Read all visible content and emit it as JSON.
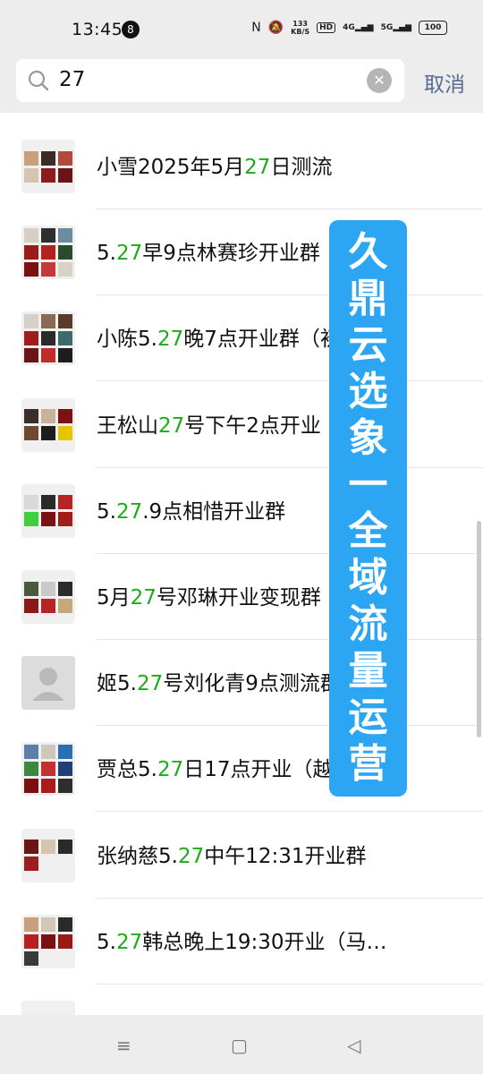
{
  "status_bar": {
    "time": "13:45",
    "badge": "8",
    "speed_top": "133",
    "speed_unit": "KB/S",
    "hd": "HD",
    "sig1": "4G",
    "sig2": "5G",
    "battery": "100"
  },
  "search": {
    "query": "27",
    "cancel_label": "取消"
  },
  "results": [
    {
      "pre": "小雪2025年5月",
      "hl": "27",
      "post": "日测流",
      "avatar": "grid",
      "colors": [
        "#c9a07a",
        "#3a2b26",
        "#b04a3c",
        "#d7c3b0",
        "#8b1c1c",
        "#6d1313"
      ]
    },
    {
      "pre": "5.",
      "hl": "27",
      "post": "早9点林赛珍开业群（新",
      "avatar": "grid",
      "colors": [
        "#d8cfc4",
        "#2f2f2f",
        "#6a8ba0",
        "#9b1a1a",
        "#b32222",
        "#2a4a2a",
        "#7b1111",
        "#c23a3a",
        "#d9d2c7"
      ]
    },
    {
      "pre": "小陈5.",
      "hl": "27",
      "post": "晚7点开业群（初选）",
      "avatar": "grid",
      "colors": [
        "#d6d0c8",
        "#8a6b52",
        "#5b3a2a",
        "#a11d1d",
        "#2a2a2a",
        "#3d6b6b",
        "#6b1414",
        "#c02b2b",
        "#1d1d1d"
      ]
    },
    {
      "pre": "王松山",
      "hl": "27",
      "post": "号下午2点开业（选",
      "avatar": "grid",
      "colors": [
        "#3a2f2a",
        "#c8b39a",
        "#7d1010",
        "#6e4a30",
        "#1e1e1e",
        "#e6c400"
      ]
    },
    {
      "pre": "5.",
      "hl": "27",
      "post": ".9点相惜开业群",
      "avatar": "grid",
      "colors": [
        "#d9d9d9",
        "#2a2a2a",
        "#b82424",
        "#3fcf3f",
        "#7a1212",
        "#a31c1c"
      ]
    },
    {
      "pre": "5月",
      "hl": "27",
      "post": "号邓琳开业变现群",
      "avatar": "grid",
      "colors": [
        "#4a5a3a",
        "#c9c9c9",
        "#2b2b2b",
        "#8d1818",
        "#b42626",
        "#c7a87a"
      ]
    },
    {
      "pre": "姬5.",
      "hl": "27",
      "post": "号刘化青9点测流群",
      "avatar": "person",
      "colors": []
    },
    {
      "pre": "贾总5.",
      "hl": "27",
      "post": "日17点开业（越",
      "avatar": "grid",
      "colors": [
        "#5b7fa8",
        "#d0c7bb",
        "#2a6fb5",
        "#3b8a3b",
        "#c23030",
        "#1f3f7a",
        "#7a1010",
        "#a81c1c",
        "#2e2e2e"
      ]
    },
    {
      "pre": "张纳慈5.",
      "hl": "27",
      "post": "中午12:31开业群",
      "avatar": "grid",
      "colors": [
        "#6b1515",
        "#d4c4b0",
        "#2a2a2a",
        "#9c1e1e"
      ]
    },
    {
      "pre": "5.",
      "hl": "27",
      "post": "韩总晚上19:30开业（马…",
      "avatar": "grid",
      "colors": [
        "#c9a07a",
        "#d2c6b8",
        "#2a2a2a",
        "#b62020",
        "#7a1010",
        "#9a1a1a",
        "#3a3a3a"
      ]
    },
    {
      "pre": "",
      "hl": "",
      "post": "",
      "avatar": "grid",
      "colors": [
        "#b5b5b5",
        "#7a1212",
        "#c2c2c2"
      ]
    }
  ],
  "overlay_text": [
    "久",
    "鼎",
    "云",
    "选",
    "象",
    "一",
    "全",
    "域",
    "流",
    "量",
    "运",
    "营"
  ],
  "nav": {
    "menu_icon": "≡",
    "home_icon": "▢",
    "back_icon": "◁"
  }
}
